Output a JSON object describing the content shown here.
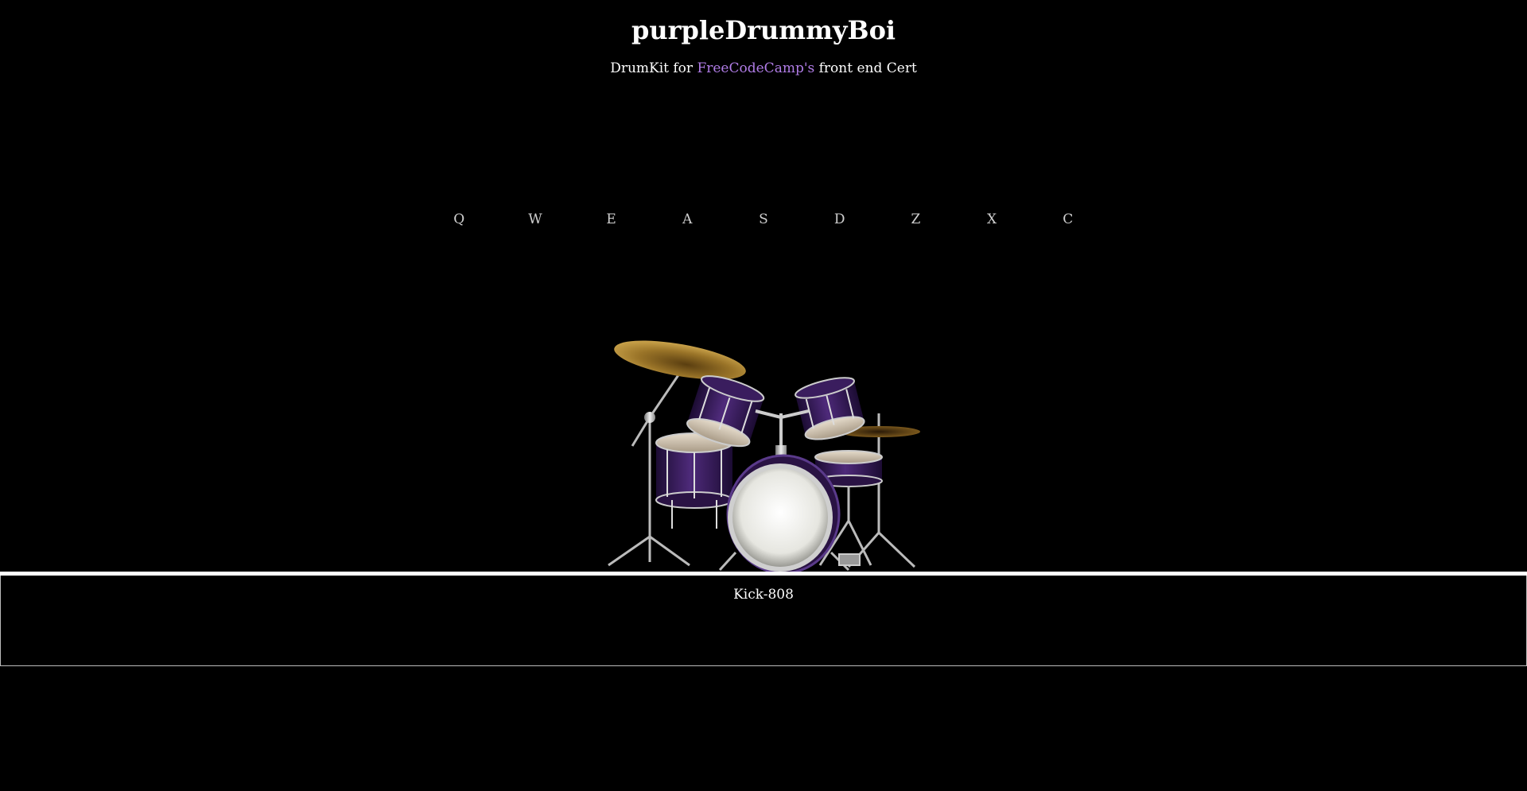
{
  "header": {
    "title": "purpleDrummyBoi",
    "subtitle_prefix": "DrumKit for ",
    "subtitle_link": "FreeCodeCamp's",
    "subtitle_suffix": " front end Cert"
  },
  "pads": [
    {
      "key": "Q"
    },
    {
      "key": "W"
    },
    {
      "key": "E"
    },
    {
      "key": "A"
    },
    {
      "key": "S"
    },
    {
      "key": "D"
    },
    {
      "key": "Z"
    },
    {
      "key": "X"
    },
    {
      "key": "C"
    }
  ],
  "display": {
    "text": "Kick-808"
  },
  "colors": {
    "background": "#000000",
    "link": "#b07ce6",
    "drum_shell": "#3a1a5e",
    "cymbal": "#a07a28"
  }
}
